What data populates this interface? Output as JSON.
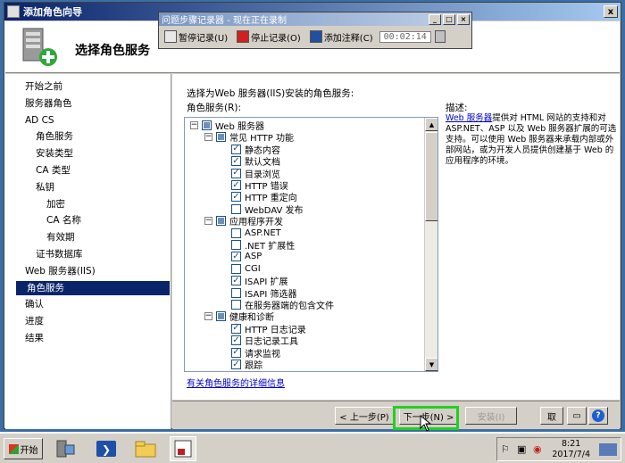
{
  "window": {
    "title": "添加角色向导",
    "close": "x"
  },
  "header": {
    "title": "选择角色服务"
  },
  "nav": {
    "items": [
      {
        "label": "开始之前",
        "indent": 0
      },
      {
        "label": "服务器角色",
        "indent": 0
      },
      {
        "label": "AD CS",
        "indent": 0
      },
      {
        "label": "角色服务",
        "indent": 1
      },
      {
        "label": "安装类型",
        "indent": 1
      },
      {
        "label": "CA 类型",
        "indent": 1
      },
      {
        "label": "私钥",
        "indent": 1
      },
      {
        "label": "加密",
        "indent": 2
      },
      {
        "label": "CA 名称",
        "indent": 2
      },
      {
        "label": "有效期",
        "indent": 2
      },
      {
        "label": "证书数据库",
        "indent": 1
      },
      {
        "label": "Web 服务器(IIS)",
        "indent": 0
      },
      {
        "label": "角色服务",
        "indent": 1,
        "active": true
      },
      {
        "label": "确认",
        "indent": 0
      },
      {
        "label": "进度",
        "indent": 0
      },
      {
        "label": "结果",
        "indent": 0
      }
    ]
  },
  "content": {
    "instruction": "选择为Web 服务器(IIS)安装的角色服务:",
    "tree_label": "角色服务(R):",
    "desc_label": "描述:",
    "desc_link": "Web 服务器",
    "desc_text": "提供对 HTML 网站的支持和对 ASP.NET、ASP 以及 Web 服务器扩展的可选支持。可以使用 Web 服务器来承载内部或外部网站，或为开发人员提供创建基于 Web 的应用程序的环境。",
    "more_link": "有关角色服务的详细信息",
    "tree": [
      {
        "label": "Web 服务器",
        "level": 0,
        "expander": "−",
        "state": "partial"
      },
      {
        "label": "常见 HTTP 功能",
        "level": 1,
        "expander": "−",
        "state": "partial"
      },
      {
        "label": "静态内容",
        "level": 2,
        "state": "checked"
      },
      {
        "label": "默认文档",
        "level": 2,
        "state": "checked"
      },
      {
        "label": "目录浏览",
        "level": 2,
        "state": "checked"
      },
      {
        "label": "HTTP 错误",
        "level": 2,
        "state": "checked"
      },
      {
        "label": "HTTP 重定向",
        "level": 2,
        "state": "checked"
      },
      {
        "label": "WebDAV 发布",
        "level": 2,
        "state": "unchecked"
      },
      {
        "label": "应用程序开发",
        "level": 1,
        "expander": "−",
        "state": "partial"
      },
      {
        "label": "ASP.NET",
        "level": 2,
        "state": "unchecked"
      },
      {
        "label": ".NET 扩展性",
        "level": 2,
        "state": "unchecked"
      },
      {
        "label": "ASP",
        "level": 2,
        "state": "checked"
      },
      {
        "label": "CGI",
        "level": 2,
        "state": "unchecked"
      },
      {
        "label": "ISAPI 扩展",
        "level": 2,
        "state": "checked"
      },
      {
        "label": "ISAPI 筛选器",
        "level": 2,
        "state": "unchecked"
      },
      {
        "label": "在服务器端的包含文件",
        "level": 2,
        "state": "unchecked"
      },
      {
        "label": "健康和诊断",
        "level": 1,
        "expander": "−",
        "state": "partial"
      },
      {
        "label": "HTTP 日志记录",
        "level": 2,
        "state": "checked"
      },
      {
        "label": "日志记录工具",
        "level": 2,
        "state": "checked"
      },
      {
        "label": "请求监视",
        "level": 2,
        "state": "checked"
      },
      {
        "label": "跟踪",
        "level": 2,
        "state": "checked"
      }
    ]
  },
  "footer": {
    "prev": "< 上一步(P)",
    "next": "下一步(N) >",
    "install": "安装(I)",
    "cancel": "取"
  },
  "recorder": {
    "title": "问题步骤记录器 - 现在正在录制",
    "pause": "暂停记录(U)",
    "stop": "停止记录(O)",
    "comment": "添加注释(C)",
    "timer": "00:02:14"
  },
  "taskbar": {
    "start": "开始",
    "time": "8:21",
    "date": "2017/7/4"
  },
  "colors": {
    "accent": "#0a246a",
    "highlight": "#22d022",
    "link": "#0000cc"
  }
}
